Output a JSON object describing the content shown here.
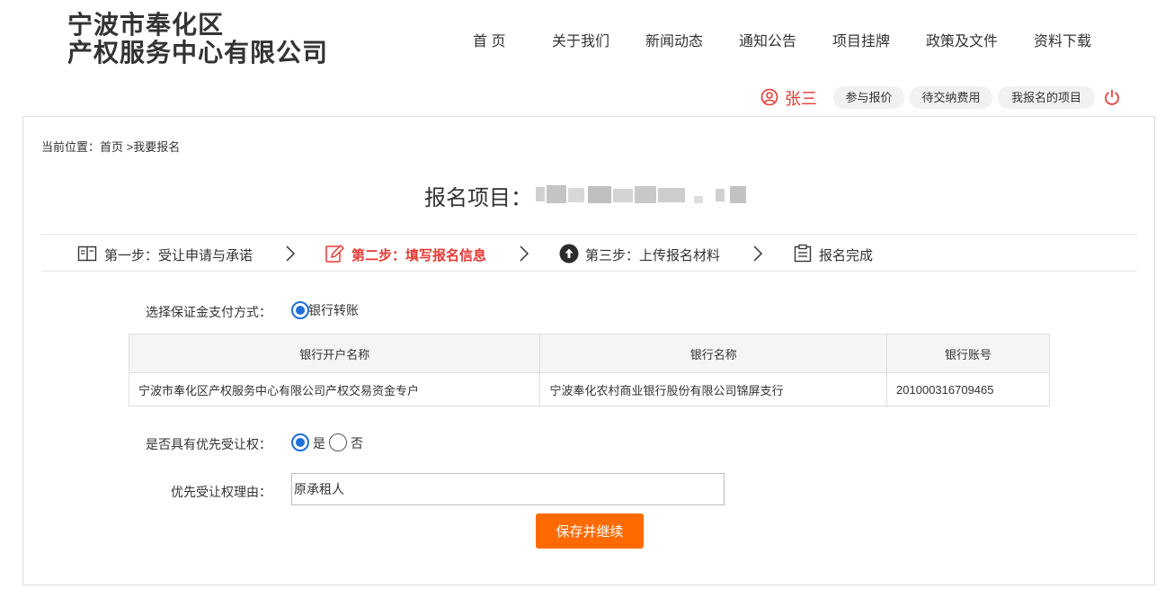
{
  "header": {
    "logo_line1": "宁波市奉化区",
    "logo_line2": "产权服务中心有限公司",
    "nav": [
      "首 页",
      "关于我们",
      "新闻动态",
      "通知公告",
      "项目挂牌",
      "政策及文件",
      "资料下载"
    ]
  },
  "userbar": {
    "user_name": "张三",
    "links": [
      "参与报价",
      "待交纳费用",
      "我报名的项目"
    ],
    "user_icon": "user-circle-icon",
    "power_icon": "power-icon",
    "accent_color": "#e53935"
  },
  "breadcrumb": "当前位置：首页 >我要报名",
  "project": {
    "title_label": "报名项目："
  },
  "steps": [
    {
      "label": "第一步：受让申请与承诺",
      "icon": "book-icon",
      "active": false
    },
    {
      "label": "第二步：填写报名信息",
      "icon": "edit-icon",
      "active": true
    },
    {
      "label": "第三步：上传报名材料",
      "icon": "upload-icon",
      "active": false
    },
    {
      "label": "报名完成",
      "icon": "clipboard-icon",
      "active": false
    }
  ],
  "payment": {
    "label": "选择保证金支付方式：",
    "option": "银行转账",
    "selected": true
  },
  "bank_table": {
    "headers": [
      "银行开户名称",
      "银行名称",
      "银行账号"
    ],
    "rows": [
      [
        "宁波市奉化区产权服务中心有限公司产权交易资金专户",
        "宁波奉化农村商业银行股份有限公司锦屏支行",
        "201000316709465"
      ]
    ]
  },
  "priority": {
    "label": "是否具有优先受让权：",
    "yes": "是",
    "no": "否",
    "selected": "是"
  },
  "reason": {
    "label": "优先受让权理由：",
    "value": "原承租人"
  },
  "save_button": "保存并继续",
  "colors": {
    "button": "#ff6a00",
    "radio": "#1e6fd9",
    "active_step": "#e53935"
  }
}
